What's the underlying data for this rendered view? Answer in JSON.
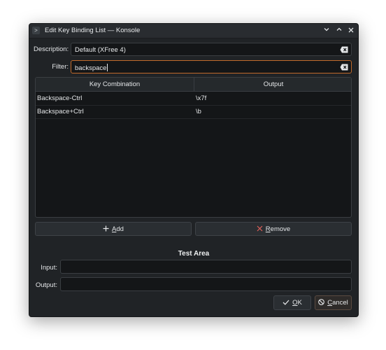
{
  "window": {
    "title": "Edit Key Binding List — Konsole",
    "app_icon": "konsole-terminal-icon"
  },
  "description": {
    "label": "Description:",
    "value": "Default (XFree 4)"
  },
  "filter": {
    "label": "Filter:",
    "value": "backspace"
  },
  "table": {
    "columns": [
      "Key Combination",
      "Output"
    ],
    "rows": [
      {
        "key": "Backspace-Ctrl",
        "output": "\\x7f"
      },
      {
        "key": "Backspace+Ctrl",
        "output": "\\b"
      }
    ]
  },
  "actions": {
    "add_prefix": "",
    "add_accel": "A",
    "add_rest": "dd",
    "remove_accel": "R",
    "remove_rest": "emove"
  },
  "test_area": {
    "title": "Test Area",
    "input_label": "Input:",
    "output_label": "Output:",
    "input_value": "",
    "output_value": ""
  },
  "dialog": {
    "ok_accel": "O",
    "ok_rest": "K",
    "cancel_accel": "C",
    "cancel_rest": "ancel"
  },
  "colors": {
    "accent": "#c06a2b",
    "remove_icon": "#e0605a",
    "background": "#202326"
  }
}
